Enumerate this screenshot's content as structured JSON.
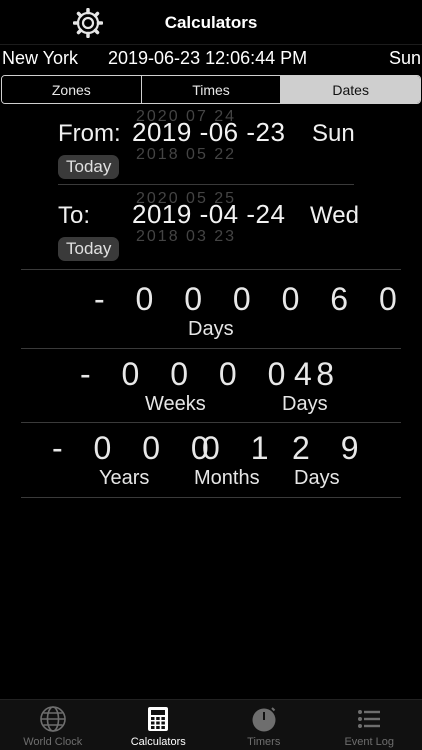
{
  "header": {
    "title": "Calculators",
    "settings_icon": "gear-icon"
  },
  "clock": {
    "city": "New York",
    "datetime": "2019-06-23 12:06:44 PM",
    "weekday": "Sun"
  },
  "segments": [
    {
      "label": "Zones",
      "active": false
    },
    {
      "label": "Times",
      "active": false
    },
    {
      "label": "Dates",
      "active": true
    }
  ],
  "from": {
    "label": "From:",
    "date": "2019 -06 -23",
    "weekday": "Sun",
    "today_label": "Today"
  },
  "to": {
    "label": "To:",
    "date": "2019 -04 -24",
    "weekday": "Wed",
    "today_label": "Today"
  },
  "days_total": {
    "value": "- 0 0 0 0 6 0",
    "unit": "Days"
  },
  "weeks_days": {
    "weeks_value": "- 0 0 0 0 8",
    "weeks_unit": "Weeks",
    "days_value": "4",
    "days_unit": "Days"
  },
  "ymd": {
    "years_value": "- 0 0 0",
    "years_unit": "Years",
    "months_value": "0 1",
    "months_unit": "Months",
    "days_value": "2 9",
    "days_unit": "Days"
  },
  "tabs": [
    {
      "label": "World Clock",
      "icon": "globe-icon",
      "active": false
    },
    {
      "label": "Calculators",
      "icon": "calculator-icon",
      "active": true
    },
    {
      "label": "Timers",
      "icon": "timer-icon",
      "active": false
    },
    {
      "label": "Event Log",
      "icon": "list-icon",
      "active": false
    }
  ],
  "colors": {
    "background": "#000000",
    "segment_active": "#cfcfcf",
    "button_bg": "#3a3a3a",
    "tab_inactive": "#6e6e6e"
  }
}
